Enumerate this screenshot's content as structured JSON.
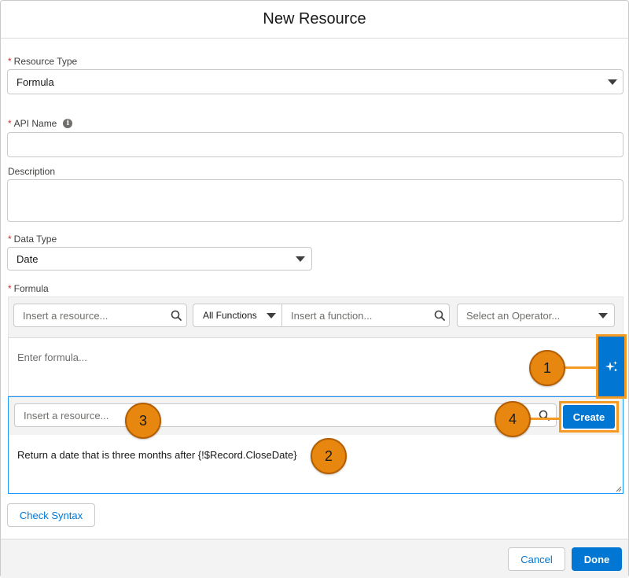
{
  "modal": {
    "title": "New Resource"
  },
  "resource_type": {
    "label": "Resource Type",
    "required_mark": "*",
    "value": "Formula"
  },
  "api_name": {
    "label": "API Name",
    "required_mark": "*",
    "info_glyph": "i",
    "value": ""
  },
  "description": {
    "label": "Description",
    "value": ""
  },
  "data_type": {
    "label": "Data Type",
    "required_mark": "*",
    "value": "Date"
  },
  "formula": {
    "label": "Formula",
    "required_mark": "*",
    "resource_placeholder": "Insert a resource...",
    "functions_filter": "All Functions",
    "function_placeholder": "Insert a function...",
    "operator_placeholder": "Select an Operator...",
    "editor_placeholder": "Enter formula..."
  },
  "ai_builder": {
    "resource_placeholder": "Insert a resource...",
    "create_label": "Create",
    "prompt_text": "Return a date that is three months after {!$Record.CloseDate}"
  },
  "callouts": [
    "1",
    "2",
    "3",
    "4"
  ],
  "check_syntax_label": "Check Syntax",
  "footer": {
    "cancel_label": "Cancel",
    "done_label": "Done"
  },
  "colors": {
    "brand": "#0176d3",
    "highlight": "#f59a23",
    "callout": "#e8870f",
    "required": "#c23934"
  },
  "icons": [
    "info-icon",
    "chevron-down-icon",
    "search-icon",
    "sparkle-icon",
    "resize-grip-icon"
  ]
}
